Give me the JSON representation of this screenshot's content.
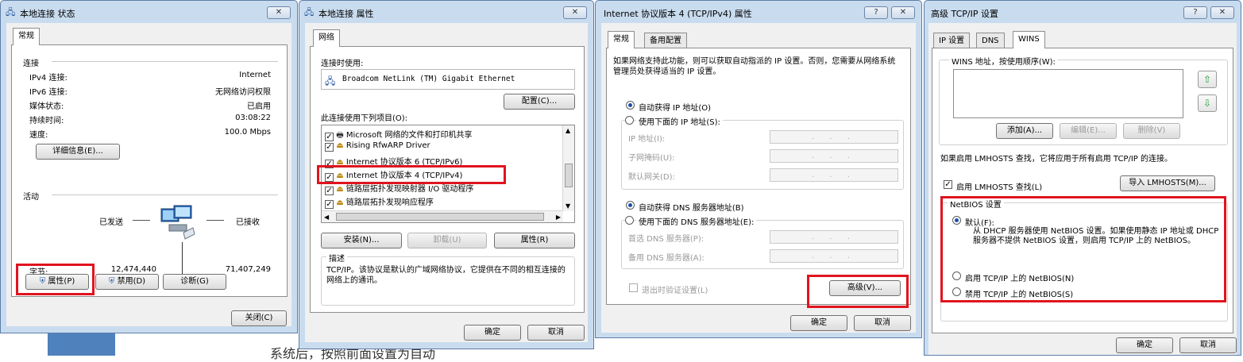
{
  "status_window": {
    "title": "本地连接 状态",
    "close_icon": "✕",
    "tab": "常规",
    "connection_header": "连接",
    "rows": [
      {
        "label": "IPv4 连接:",
        "value": "Internet"
      },
      {
        "label": "IPv6 连接:",
        "value": "无网络访问权限"
      },
      {
        "label": "媒体状态:",
        "value": "已启用"
      },
      {
        "label": "持续时间:",
        "value": "03:08:22"
      },
      {
        "label": "速度:",
        "value": "100.0 Mbps"
      }
    ],
    "details_button": "详细信息(E)...",
    "activity_header": "活动",
    "sent_label": "已发送",
    "received_label": "已接收",
    "bytes_label": "字节:",
    "bytes_sent": "12,474,440",
    "bytes_received": "71,407,249",
    "properties_button": "属性(P)",
    "disable_button": "禁用(D)",
    "diagnose_button": "诊断(G)",
    "close_button": "关闭(C)"
  },
  "props_window": {
    "title": "本地连接 属性",
    "tab": "网络",
    "connect_using_label": "连接时使用:",
    "adapter_name": "Broadcom NetLink (TM) Gigabit Ethernet",
    "configure_button": "配置(C)...",
    "items_label": "此连接使用下列项目(O):",
    "items": [
      "Microsoft 网络的文件和打印机共享",
      "Rising RfwARP Driver",
      "Internet 协议版本 6 (TCP/IPv6)",
      "Internet 协议版本 4 (TCP/IPv4)",
      "链路层拓扑发现映射器 I/O 驱动程序",
      "链路层拓扑发现响应程序"
    ],
    "install_button": "安装(N)...",
    "uninstall_button": "卸载(U)",
    "properties_button": "属性(R)",
    "description_title": "描述",
    "description_text": "TCP/IP。该协议是默认的广域网络协议，它提供在不同的相互连接的网络上的通讯。",
    "ok_button": "确定",
    "cancel_button": "取消"
  },
  "ipv4_window": {
    "title": "Internet 协议版本 4 (TCP/IPv4) 属性",
    "help_icon": "?",
    "tabs": [
      "常规",
      "备用配置"
    ],
    "intro": "如果网络支持此功能，则可以获取自动指派的 IP 设置。否则，您需要从网络系统管理员处获得适当的 IP 设置。",
    "auto_ip": "自动获得 IP 地址(O)",
    "manual_ip": "使用下面的 IP 地址(S):",
    "ip_address_label": "IP 地址(I):",
    "subnet_label": "子网掩码(U):",
    "gateway_label": "默认网关(D):",
    "auto_dns": "自动获得 DNS 服务器地址(B)",
    "manual_dns": "使用下面的 DNS 服务器地址(E):",
    "preferred_dns_label": "首选 DNS 服务器(P):",
    "alternate_dns_label": "备用 DNS 服务器(A):",
    "ip_placeholder": ". . .",
    "validate_label": "退出时验证设置(L)",
    "advanced_button": "高级(V)...",
    "ok_button": "确定",
    "cancel_button": "取消"
  },
  "advanced_window": {
    "title": "高级 TCP/IP 设置",
    "tabs": [
      "IP 设置",
      "DNS",
      "WINS"
    ],
    "wins_label": "WINS 地址，按使用顺序(W):",
    "add_button": "添加(A)...",
    "edit_button": "编辑(E)...",
    "delete_button": "删除(V)",
    "lmhosts_note": "如果启用 LMHOSTS 查找，它将应用于所有启用 TCP/IP 的连接。",
    "lmhosts_check": "启用 LMHOSTS 查找(L)",
    "import_button": "导入 LMHOSTS(M)...",
    "netbios_title": "NetBIOS 设置",
    "default_option": "默认(F):",
    "default_desc": "从 DHCP 服务器使用 NetBIOS 设置。如果使用静态 IP 地址或 DHCP 服务器不提供 NetBIOS 设置，则启用 TCP/IP 上的 NetBIOS。",
    "enable_option": "启用 TCP/IP 上的 NetBIOS(N)",
    "disable_option": "禁用 TCP/IP 上的 NetBIOS(S)",
    "ok_button": "确定",
    "cancel_button": "取消"
  },
  "background_text": "系统后，按照前面设置为自动"
}
